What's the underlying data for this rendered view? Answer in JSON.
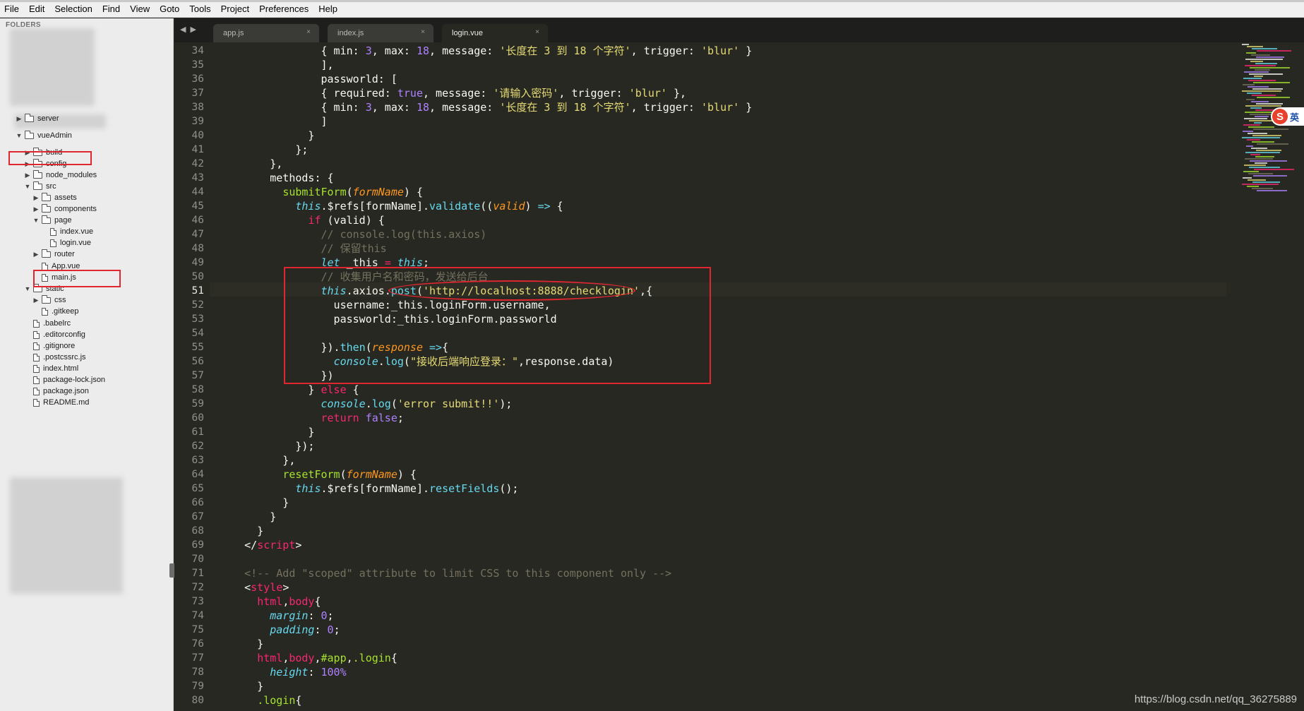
{
  "menu": [
    "File",
    "Edit",
    "Selection",
    "Find",
    "View",
    "Goto",
    "Tools",
    "Project",
    "Preferences",
    "Help"
  ],
  "sidebar": {
    "header": "FOLDERS",
    "items": [
      {
        "label": "server",
        "type": "folder",
        "open": false,
        "depth": 1
      },
      {
        "label": "vueAdmin",
        "type": "folder",
        "open": true,
        "depth": 1
      },
      {
        "label": "build",
        "type": "folder",
        "open": false,
        "depth": 2
      },
      {
        "label": "config",
        "type": "folder",
        "open": false,
        "depth": 2
      },
      {
        "label": "node_modules",
        "type": "folder",
        "open": false,
        "depth": 2
      },
      {
        "label": "src",
        "type": "folder",
        "open": true,
        "depth": 2
      },
      {
        "label": "assets",
        "type": "folder",
        "open": false,
        "depth": 3
      },
      {
        "label": "components",
        "type": "folder",
        "open": false,
        "depth": 3
      },
      {
        "label": "page",
        "type": "folder",
        "open": true,
        "depth": 3
      },
      {
        "label": "index.vue",
        "type": "file",
        "depth": 4
      },
      {
        "label": "login.vue",
        "type": "file",
        "depth": 4
      },
      {
        "label": "router",
        "type": "folder",
        "open": false,
        "depth": 3
      },
      {
        "label": "App.vue",
        "type": "file",
        "depth": 3
      },
      {
        "label": "main.js",
        "type": "file",
        "depth": 3
      },
      {
        "label": "static",
        "type": "folder",
        "open": true,
        "depth": 2
      },
      {
        "label": "css",
        "type": "folder",
        "open": false,
        "depth": 3
      },
      {
        "label": ".gitkeep",
        "type": "file",
        "depth": 3
      },
      {
        "label": ".babelrc",
        "type": "file",
        "depth": 2
      },
      {
        "label": ".editorconfig",
        "type": "file",
        "depth": 2
      },
      {
        "label": ".gitignore",
        "type": "file",
        "depth": 2
      },
      {
        "label": ".postcssrc.js",
        "type": "file",
        "depth": 2
      },
      {
        "label": "index.html",
        "type": "file",
        "depth": 2
      },
      {
        "label": "package-lock.json",
        "type": "file",
        "depth": 2
      },
      {
        "label": "package.json",
        "type": "file",
        "depth": 2
      },
      {
        "label": "README.md",
        "type": "file",
        "depth": 2
      }
    ]
  },
  "tabs": [
    {
      "label": "app.js",
      "active": false
    },
    {
      "label": "index.js",
      "active": false
    },
    {
      "label": "login.vue",
      "active": true
    }
  ],
  "editor": {
    "current_line": 51,
    "lines": [
      {
        "no": "34",
        "tokens": [
          [
            "",
            "                { min: "
          ],
          [
            "n",
            "3"
          ],
          [
            "",
            ", max: "
          ],
          [
            "n",
            "18"
          ],
          [
            "",
            ", message: "
          ],
          [
            "s",
            "'长度在 3 到 18 个字符'"
          ],
          [
            "",
            ", trigger: "
          ],
          [
            "s",
            "'blur'"
          ],
          [
            "",
            " }"
          ]
        ]
      },
      {
        "no": "35",
        "tokens": [
          [
            "",
            "                ],"
          ]
        ]
      },
      {
        "no": "36",
        "tokens": [
          [
            "",
            "                passworld: ["
          ]
        ]
      },
      {
        "no": "37",
        "tokens": [
          [
            "",
            "                { required: "
          ],
          [
            "n",
            "true"
          ],
          [
            "",
            ", message: "
          ],
          [
            "s",
            "'请输入密码'"
          ],
          [
            "",
            ", trigger: "
          ],
          [
            "s",
            "'blur'"
          ],
          [
            "",
            " },"
          ]
        ]
      },
      {
        "no": "38",
        "tokens": [
          [
            "",
            "                { min: "
          ],
          [
            "n",
            "3"
          ],
          [
            "",
            ", max: "
          ],
          [
            "n",
            "18"
          ],
          [
            "",
            ", message: "
          ],
          [
            "s",
            "'长度在 3 到 18 个字符'"
          ],
          [
            "",
            ", trigger: "
          ],
          [
            "s",
            "'blur'"
          ],
          [
            "",
            " }"
          ]
        ]
      },
      {
        "no": "39",
        "tokens": [
          [
            "",
            "                ]"
          ]
        ]
      },
      {
        "no": "40",
        "tokens": [
          [
            "",
            "              }"
          ]
        ]
      },
      {
        "no": "41",
        "tokens": [
          [
            "",
            "            };"
          ]
        ]
      },
      {
        "no": "42",
        "tokens": [
          [
            "",
            "        },"
          ]
        ]
      },
      {
        "no": "43",
        "tokens": [
          [
            "",
            "        methods: {"
          ]
        ]
      },
      {
        "no": "44",
        "tokens": [
          [
            "",
            "          "
          ],
          [
            "f",
            "submitForm"
          ],
          [
            "",
            "("
          ],
          [
            "p",
            "formName"
          ],
          [
            "",
            ") {"
          ]
        ]
      },
      {
        "no": "45",
        "tokens": [
          [
            "",
            "            "
          ],
          [
            "t",
            "this"
          ],
          [
            "",
            ".$refs[formName]."
          ],
          [
            "fx",
            "validate"
          ],
          [
            "",
            "(("
          ],
          [
            "p",
            "valid"
          ],
          [
            "",
            ") "
          ],
          [
            "fx",
            "=>"
          ],
          [
            "",
            " {"
          ]
        ]
      },
      {
        "no": "46",
        "tokens": [
          [
            "",
            "              "
          ],
          [
            "k",
            "if"
          ],
          [
            "",
            " (valid) {"
          ]
        ]
      },
      {
        "no": "47",
        "tokens": [
          [
            "",
            "                "
          ],
          [
            "c",
            "// console.log(this.axios)"
          ]
        ]
      },
      {
        "no": "48",
        "tokens": [
          [
            "",
            "                "
          ],
          [
            "c",
            "// 保留this"
          ]
        ]
      },
      {
        "no": "49",
        "tokens": [
          [
            "",
            "                "
          ],
          [
            "t",
            "let"
          ],
          [
            "",
            " _this "
          ],
          [
            "k",
            "="
          ],
          [
            "",
            " "
          ],
          [
            "t",
            "this"
          ],
          [
            "",
            ";"
          ]
        ]
      },
      {
        "no": "50",
        "tokens": [
          [
            "",
            "                "
          ],
          [
            "c",
            "// 收集用户名和密码，发送给后台"
          ]
        ]
      },
      {
        "no": "51",
        "tokens": [
          [
            "",
            "                "
          ],
          [
            "t",
            "this"
          ],
          [
            "",
            ".axios."
          ],
          [
            "fx",
            "post"
          ],
          [
            "",
            "("
          ],
          [
            "s",
            "'http://localhost:8888/checklogin'"
          ],
          [
            "",
            ",{"
          ]
        ]
      },
      {
        "no": "52",
        "tokens": [
          [
            "",
            "                  username:_this.loginForm.username,"
          ]
        ]
      },
      {
        "no": "53",
        "tokens": [
          [
            "",
            "                  passworld:_this.loginForm.passworld"
          ]
        ]
      },
      {
        "no": "54",
        "tokens": [
          [
            "",
            ""
          ]
        ]
      },
      {
        "no": "55",
        "tokens": [
          [
            "",
            "                })."
          ],
          [
            "fx",
            "then"
          ],
          [
            "",
            "("
          ],
          [
            "p",
            "response"
          ],
          [
            "",
            " "
          ],
          [
            "fx",
            "=>"
          ],
          [
            "",
            "{"
          ]
        ]
      },
      {
        "no": "56",
        "tokens": [
          [
            "",
            "                  "
          ],
          [
            "t",
            "console"
          ],
          [
            "",
            "."
          ],
          [
            "fx",
            "log"
          ],
          [
            "",
            "("
          ],
          [
            "s",
            "\"接收后端响应登录：\""
          ],
          [
            "",
            ",response.data)"
          ]
        ]
      },
      {
        "no": "57",
        "tokens": [
          [
            "",
            "                })"
          ]
        ]
      },
      {
        "no": "58",
        "tokens": [
          [
            "",
            "              } "
          ],
          [
            "k",
            "else"
          ],
          [
            "",
            " {"
          ]
        ]
      },
      {
        "no": "59",
        "tokens": [
          [
            "",
            "                "
          ],
          [
            "t",
            "console"
          ],
          [
            "",
            "."
          ],
          [
            "fx",
            "log"
          ],
          [
            "",
            "("
          ],
          [
            "s",
            "'error submit!!'"
          ],
          [
            "",
            ");"
          ]
        ]
      },
      {
        "no": "60",
        "tokens": [
          [
            "",
            "                "
          ],
          [
            "k",
            "return"
          ],
          [
            "",
            " "
          ],
          [
            "n",
            "false"
          ],
          [
            "",
            ";"
          ]
        ]
      },
      {
        "no": "61",
        "tokens": [
          [
            "",
            "              }"
          ]
        ]
      },
      {
        "no": "62",
        "tokens": [
          [
            "",
            "            });"
          ]
        ]
      },
      {
        "no": "63",
        "tokens": [
          [
            "",
            "          },"
          ]
        ]
      },
      {
        "no": "64",
        "tokens": [
          [
            "",
            "          "
          ],
          [
            "f",
            "resetForm"
          ],
          [
            "",
            "("
          ],
          [
            "p",
            "formName"
          ],
          [
            "",
            ") {"
          ]
        ]
      },
      {
        "no": "65",
        "tokens": [
          [
            "",
            "            "
          ],
          [
            "t",
            "this"
          ],
          [
            "",
            ".$refs[formName]."
          ],
          [
            "fx",
            "resetFields"
          ],
          [
            "",
            "();"
          ]
        ]
      },
      {
        "no": "66",
        "tokens": [
          [
            "",
            "          }"
          ]
        ]
      },
      {
        "no": "67",
        "tokens": [
          [
            "",
            "        }"
          ]
        ]
      },
      {
        "no": "68",
        "tokens": [
          [
            "",
            "      }"
          ]
        ]
      },
      {
        "no": "69",
        "tokens": [
          [
            "",
            "    </"
          ],
          [
            "k",
            "script"
          ],
          [
            "",
            ">"
          ]
        ]
      },
      {
        "no": "70",
        "tokens": [
          [
            "",
            ""
          ]
        ]
      },
      {
        "no": "71",
        "tokens": [
          [
            "",
            "    "
          ],
          [
            "c",
            "<!-- Add \"scoped\" attribute to limit CSS to this component only -->"
          ]
        ]
      },
      {
        "no": "72",
        "tokens": [
          [
            "",
            "    <"
          ],
          [
            "k",
            "style"
          ],
          [
            "",
            ">"
          ]
        ]
      },
      {
        "no": "73",
        "tokens": [
          [
            "",
            "      "
          ],
          [
            "k",
            "html"
          ],
          [
            "",
            ","
          ],
          [
            "k",
            "body"
          ],
          [
            "",
            "{"
          ]
        ]
      },
      {
        "no": "74",
        "tokens": [
          [
            "",
            "        "
          ],
          [
            "t",
            "margin"
          ],
          [
            "",
            ": "
          ],
          [
            "n",
            "0"
          ],
          [
            "",
            ";"
          ]
        ]
      },
      {
        "no": "75",
        "tokens": [
          [
            "",
            "        "
          ],
          [
            "t",
            "padding"
          ],
          [
            "",
            ": "
          ],
          [
            "n",
            "0"
          ],
          [
            "",
            ";"
          ]
        ]
      },
      {
        "no": "76",
        "tokens": [
          [
            "",
            "      }"
          ]
        ]
      },
      {
        "no": "77",
        "tokens": [
          [
            "",
            "      "
          ],
          [
            "k",
            "html"
          ],
          [
            "",
            ","
          ],
          [
            "k",
            "body"
          ],
          [
            "",
            ","
          ],
          [
            "f",
            "#app"
          ],
          [
            "",
            ","
          ],
          [
            "f",
            ".login"
          ],
          [
            "",
            "{"
          ]
        ]
      },
      {
        "no": "78",
        "tokens": [
          [
            "",
            "        "
          ],
          [
            "t",
            "height"
          ],
          [
            "",
            ": "
          ],
          [
            "n",
            "100%"
          ]
        ]
      },
      {
        "no": "79",
        "tokens": [
          [
            "",
            "      }"
          ]
        ]
      },
      {
        "no": "80",
        "tokens": [
          [
            "",
            "      "
          ],
          [
            "f",
            ".login"
          ],
          [
            "",
            "{"
          ]
        ]
      }
    ]
  },
  "ime": {
    "label": "英"
  },
  "watermark": "https://blog.csdn.net/qq_36275889"
}
